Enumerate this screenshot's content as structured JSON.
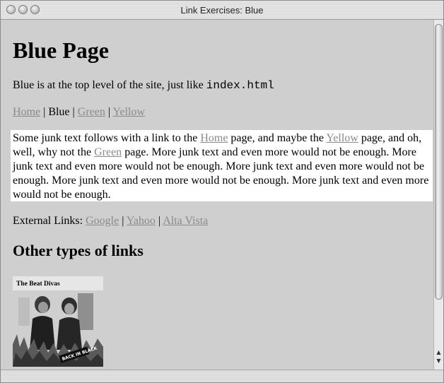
{
  "window": {
    "title": "Link Exercises: Blue"
  },
  "page": {
    "heading": "Blue Page",
    "intro_text": "Blue is at the top level of the site, just like ",
    "intro_code": "index.html",
    "nav": {
      "home": "Home",
      "sep1": " | ",
      "blue": "Blue",
      "sep2": " | ",
      "green": "Green",
      "sep3": " | ",
      "yellow": "Yellow"
    },
    "paragraph": {
      "t1": "Some junk text follows with a link to the ",
      "home_link": "Home",
      "t2": " page, and maybe the ",
      "yellow_link": "Yellow",
      "t3": " page, and oh, well, why not the ",
      "green_link": "Green",
      "t4": " page. More junk text and even more would not be enough. More junk text and even more would not be enough. More junk text and even more would not be enough. More junk text and even more would not be enough. More junk text and even more would not be enough."
    },
    "external": {
      "label": "External Links: ",
      "google": "Google",
      "sep1": " | ",
      "yahoo": "Yahoo",
      "sep2": " | ",
      "altavista": "Alta Vista"
    },
    "other_heading": "Other types of links",
    "album": {
      "title": "The Beat Divas",
      "sticker": "BACK IN BLACK"
    }
  },
  "colors": {
    "link": "#8a8a8a",
    "page_bg": "#cfcfcf",
    "para_bg": "#ffffff"
  }
}
